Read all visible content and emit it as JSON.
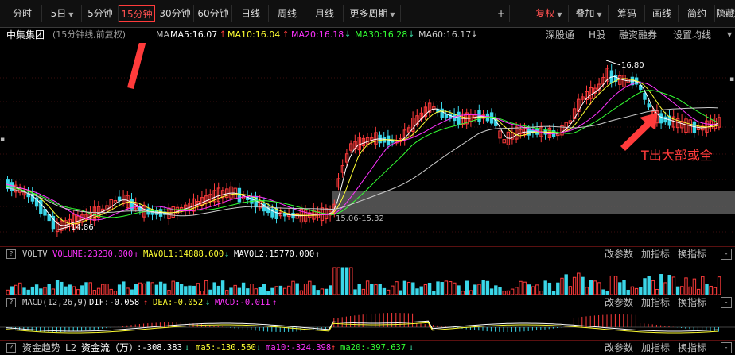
{
  "toolbar": {
    "periods": [
      "分时",
      "5日",
      "5分钟",
      "15分钟",
      "30分钟",
      "60分钟",
      "日线",
      "周线",
      "月线",
      "更多周期"
    ],
    "right": [
      "+",
      "—",
      "复权",
      "叠加",
      "筹码",
      "画线",
      "简约",
      "隐藏"
    ]
  },
  "stock": {
    "name": "中集集团",
    "desc": "(15分钟线,前复权)",
    "ma_toggle": "MA",
    "ma5": "MA5:16.07",
    "ma10": "MA10:16.04",
    "ma20": "MA20:16.18",
    "ma30": "MA30:16.28",
    "ma60": "MA60:16.17",
    "links": [
      "深股通",
      "H股",
      "融资融券",
      "设置均线"
    ]
  },
  "annotations": {
    "high": "16.80",
    "low": "14.86",
    "range": "15.06-15.32",
    "callout": "T出大部或全"
  },
  "volume_panel": {
    "name": "VOLTV",
    "volume": "VOLUME:23230.000",
    "mavol1": "MAVOL1:14888.600",
    "mavol2": "MAVOL2:15770.000",
    "actions": [
      "改参数",
      "加指标",
      "换指标"
    ]
  },
  "macd_panel": {
    "name": "MACD(12,26,9)",
    "dif": "DIF:-0.058",
    "dea": "DEA:-0.052",
    "macd": "MACD:-0.011",
    "actions": [
      "改参数",
      "加指标",
      "换指标"
    ]
  },
  "flow_panel": {
    "name": "资金趋势_L2",
    "title": "资金流（万）",
    "value": ":-308.383",
    "ma5": "ma5:-130.560",
    "ma10": "ma10:-324.398",
    "ma20": "ma20:-397.637",
    "actions": [
      "改参数",
      "加指标",
      "换指标"
    ]
  },
  "colors": {
    "up": "#ff3b3b",
    "down": "#3ad6e8",
    "ma5": "#ffffff",
    "ma10": "#ffff33",
    "ma20": "#ff33ff",
    "ma30": "#33ff33",
    "ma60": "#cccccc"
  }
}
